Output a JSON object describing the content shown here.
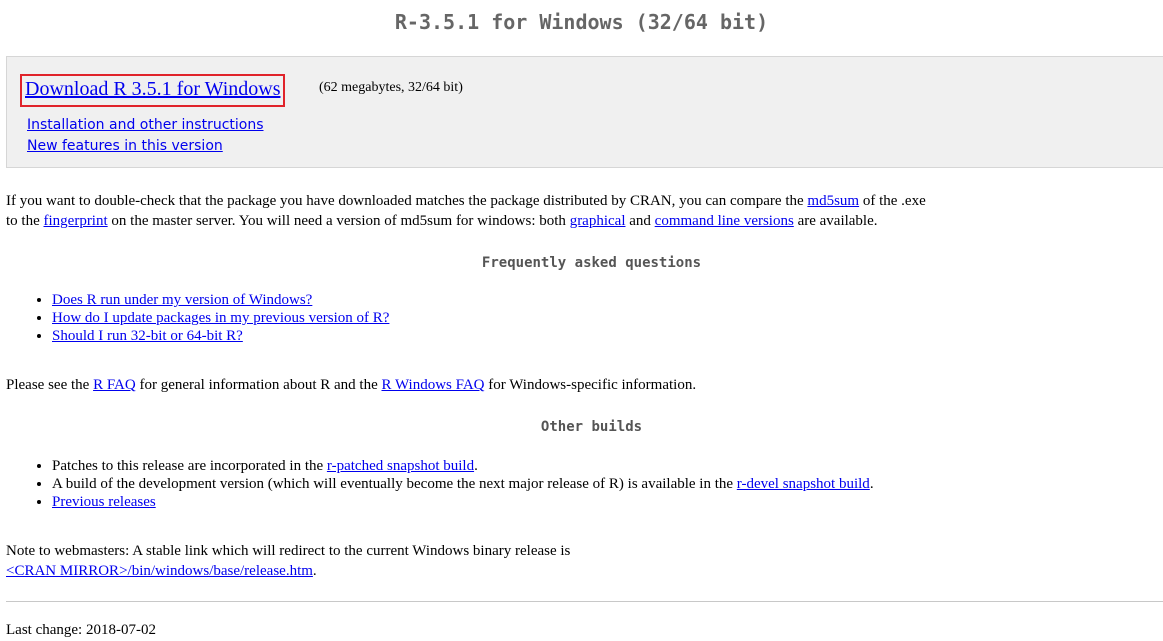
{
  "page": {
    "title": "R-3.5.1 for Windows (32/64 bit)"
  },
  "download_box": {
    "main_link": "Download R 3.5.1 for Windows",
    "size_note": "(62 megabytes, 32/64 bit)",
    "instructions_link": "Installation and other instructions",
    "new_features_link": "New features in this version",
    "highlight_color": "#e0232a"
  },
  "md5_paragraph": {
    "part1": "If you want to double-check that the package you have downloaded matches the package distributed by CRAN, you can compare the ",
    "md5sum_link": "md5sum",
    "part2": " of the .exe",
    "part3": "to the ",
    "fingerprint_link": "fingerprint",
    "part4": " on the master server. You will need a version of md5sum for windows: both ",
    "graphical_link": "graphical",
    "part5": " and ",
    "command_line_link": "command line versions",
    "part6": " are available."
  },
  "faq": {
    "heading": "Frequently asked questions",
    "items": [
      "Does R run under my version of Windows?",
      "How do I update packages in my previous version of R?",
      "Should I run 32-bit or 64-bit R?"
    ]
  },
  "faq_paragraph": {
    "part1": "Please see the ",
    "rfaq_link": "R FAQ",
    "part2": " for general information about R and the ",
    "rwinfaq_link": "R Windows FAQ",
    "part3": " for Windows-specific information."
  },
  "other_builds": {
    "heading": "Other builds",
    "item1_text": "Patches to this release are incorporated in the ",
    "item1_link": "r-patched snapshot build",
    "item1_end": ".",
    "item2_text": "A build of the development version (which will eventually become the next major release of R) is available in the ",
    "item2_link": "r-devel snapshot build",
    "item2_end": ".",
    "item3_link": "Previous releases"
  },
  "webmasters": {
    "text": "Note to webmasters: A stable link which will redirect to the current Windows binary release is",
    "link": "<CRAN MIRROR>/bin/windows/base/release.htm",
    "end": "."
  },
  "footer": {
    "last_change": "Last change: 2018-07-02"
  },
  "colors": {
    "link": "#0000ee",
    "title": "#666666",
    "box_background": "#f0f0f0"
  }
}
